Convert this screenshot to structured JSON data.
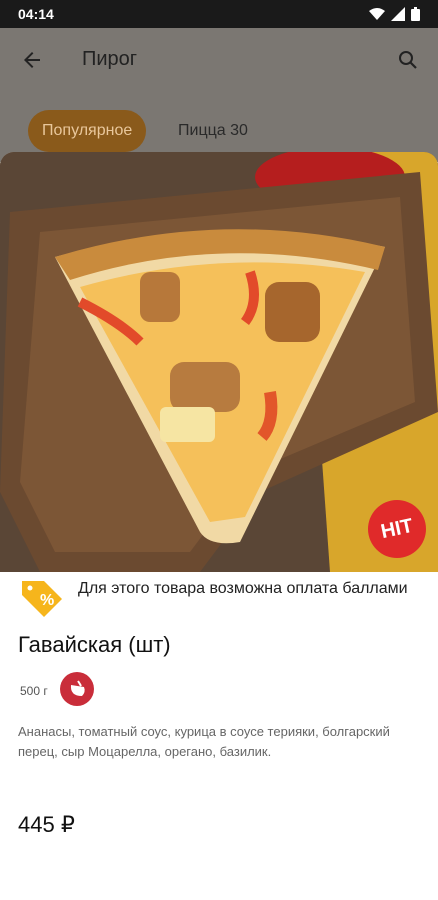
{
  "status_bar": {
    "time": "04:14"
  },
  "app_bar": {
    "title": "Пирог"
  },
  "tabs": [
    {
      "label": "Популярное"
    },
    {
      "label": "Пицца 30"
    }
  ],
  "product": {
    "badge": "HIT",
    "promo_text": "Для этого товара возможна оплата баллами",
    "title": "Гавайская (шт)",
    "weight": "500 г",
    "description": "Ананасы, томатный соус, курица в соусе терияки, болгарский перец, сыр Моцарелла, орегано, базилик.",
    "price": "445 ₽"
  },
  "colors": {
    "accent": "#8a5a1b",
    "badge": "#e02a2a",
    "promo": "#f6b51c"
  }
}
